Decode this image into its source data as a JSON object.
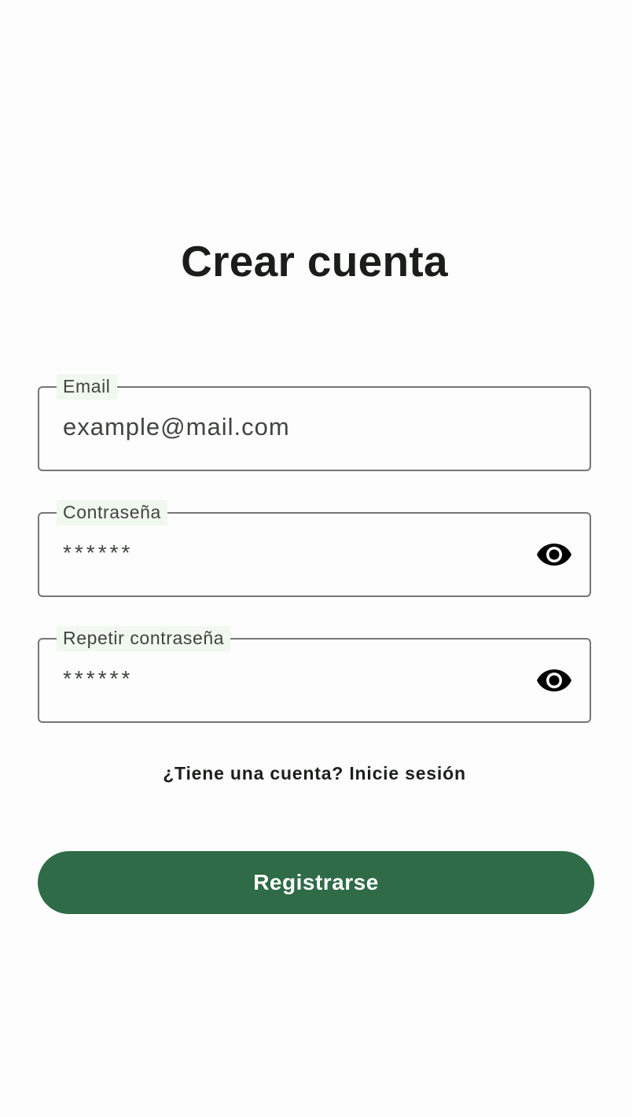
{
  "page": {
    "title": "Crear cuenta"
  },
  "form": {
    "email": {
      "label": "Email",
      "value": "example@mail.com"
    },
    "password": {
      "label": "Contraseña",
      "value": "******",
      "toggle_icon": "eye-icon"
    },
    "repeat_password": {
      "label": "Repetir contraseña",
      "value": "******",
      "toggle_icon": "eye-icon"
    },
    "login_prompt": "¿Tiene una cuenta? Inicie sesión",
    "submit_label": "Registrarse"
  },
  "colors": {
    "primary": "#2E6B46",
    "label_background": "#F1F8EF",
    "field_border": "#747774",
    "text": "#1B1D1A"
  }
}
